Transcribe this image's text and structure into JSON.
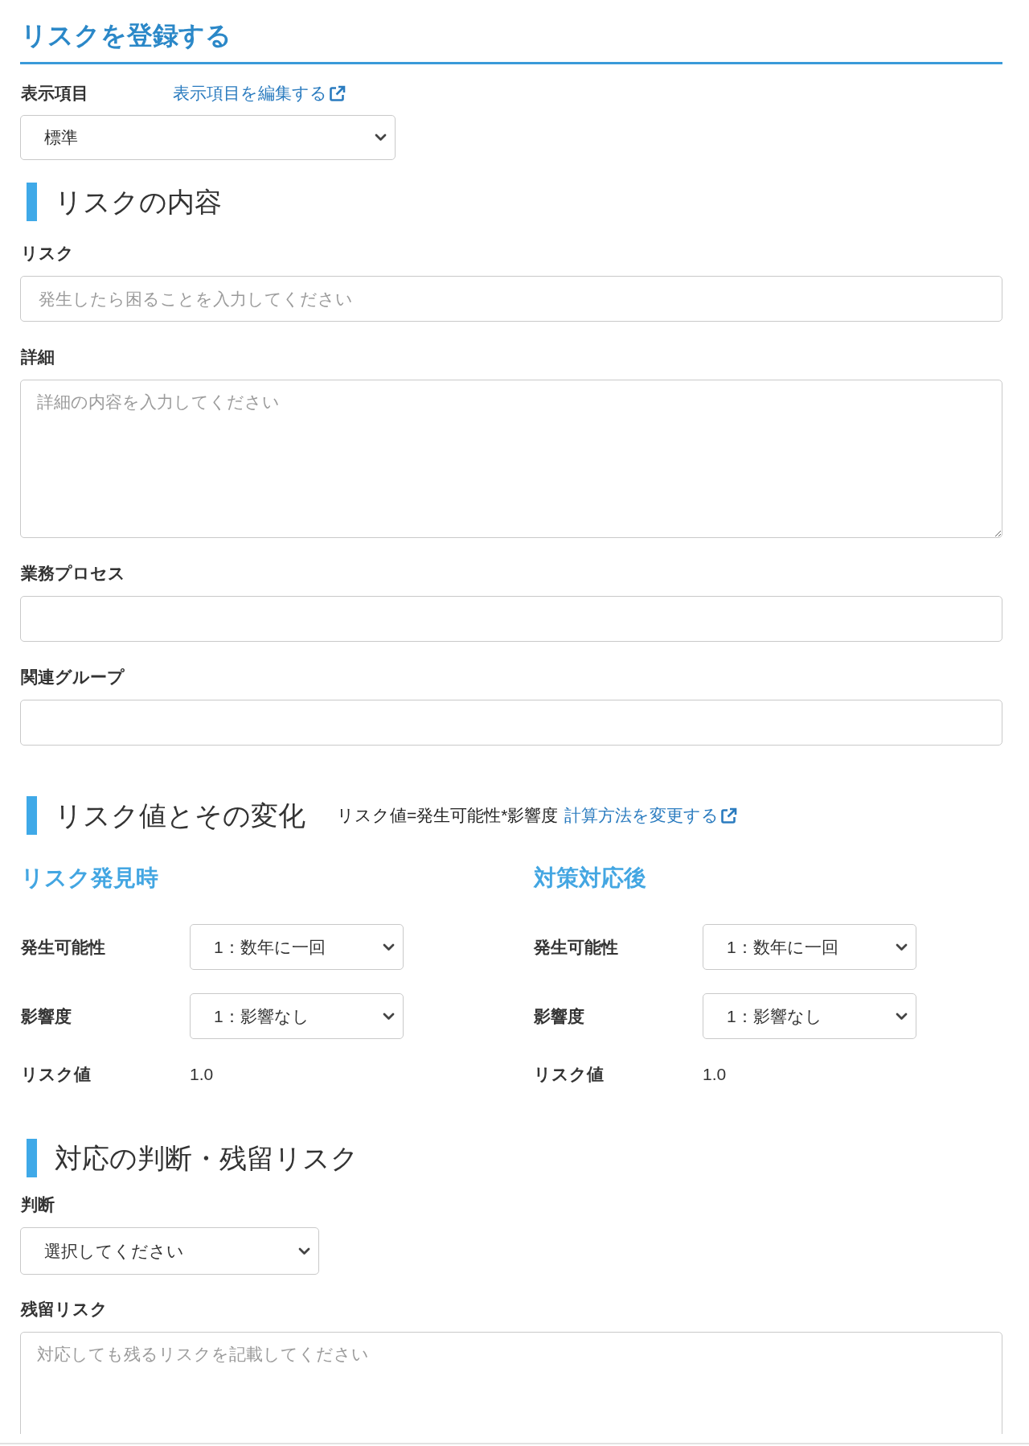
{
  "page_title": "リスクを登録する",
  "display_items": {
    "label": "表示項目",
    "link": "表示項目を編集する",
    "value": "標準"
  },
  "risk_content": {
    "heading": "リスクの内容",
    "fields": [
      {
        "kind": "input",
        "label": "リスク",
        "placeholder": "発生したら困ることを入力してください"
      },
      {
        "kind": "textarea",
        "label": "詳細",
        "placeholder": "詳細の内容を入力してください"
      },
      {
        "kind": "input",
        "label": "業務プロセス"
      },
      {
        "kind": "input",
        "label": "関連グループ"
      }
    ]
  },
  "risk_value": {
    "heading": "リスク値とその変化",
    "formula": "リスク値=発生可能性*影響度",
    "link": "計算方法を変更する",
    "columns": [
      {
        "title": "リスク発見時",
        "rows": [
          {
            "kind": "select",
            "label": "発生可能性",
            "value": "1：数年に一回"
          },
          {
            "kind": "select",
            "label": "影響度",
            "value": "1：影響なし"
          },
          {
            "kind": "text",
            "label": "リスク値",
            "value": "1.0"
          }
        ]
      },
      {
        "title": "対策対応後",
        "rows": [
          {
            "kind": "select",
            "label": "発生可能性",
            "value": "1：数年に一回"
          },
          {
            "kind": "select",
            "label": "影響度",
            "value": "1：影響なし"
          },
          {
            "kind": "text",
            "label": "リスク値",
            "value": "1.0"
          }
        ]
      }
    ]
  },
  "response": {
    "heading": "対応の判断・残留リスク",
    "fields": [
      {
        "kind": "select",
        "label": "判断",
        "value": "選択してください"
      },
      {
        "kind": "textarea",
        "label": "残留リスク",
        "placeholder": "対応しても残るリスクを記載してください"
      }
    ]
  }
}
